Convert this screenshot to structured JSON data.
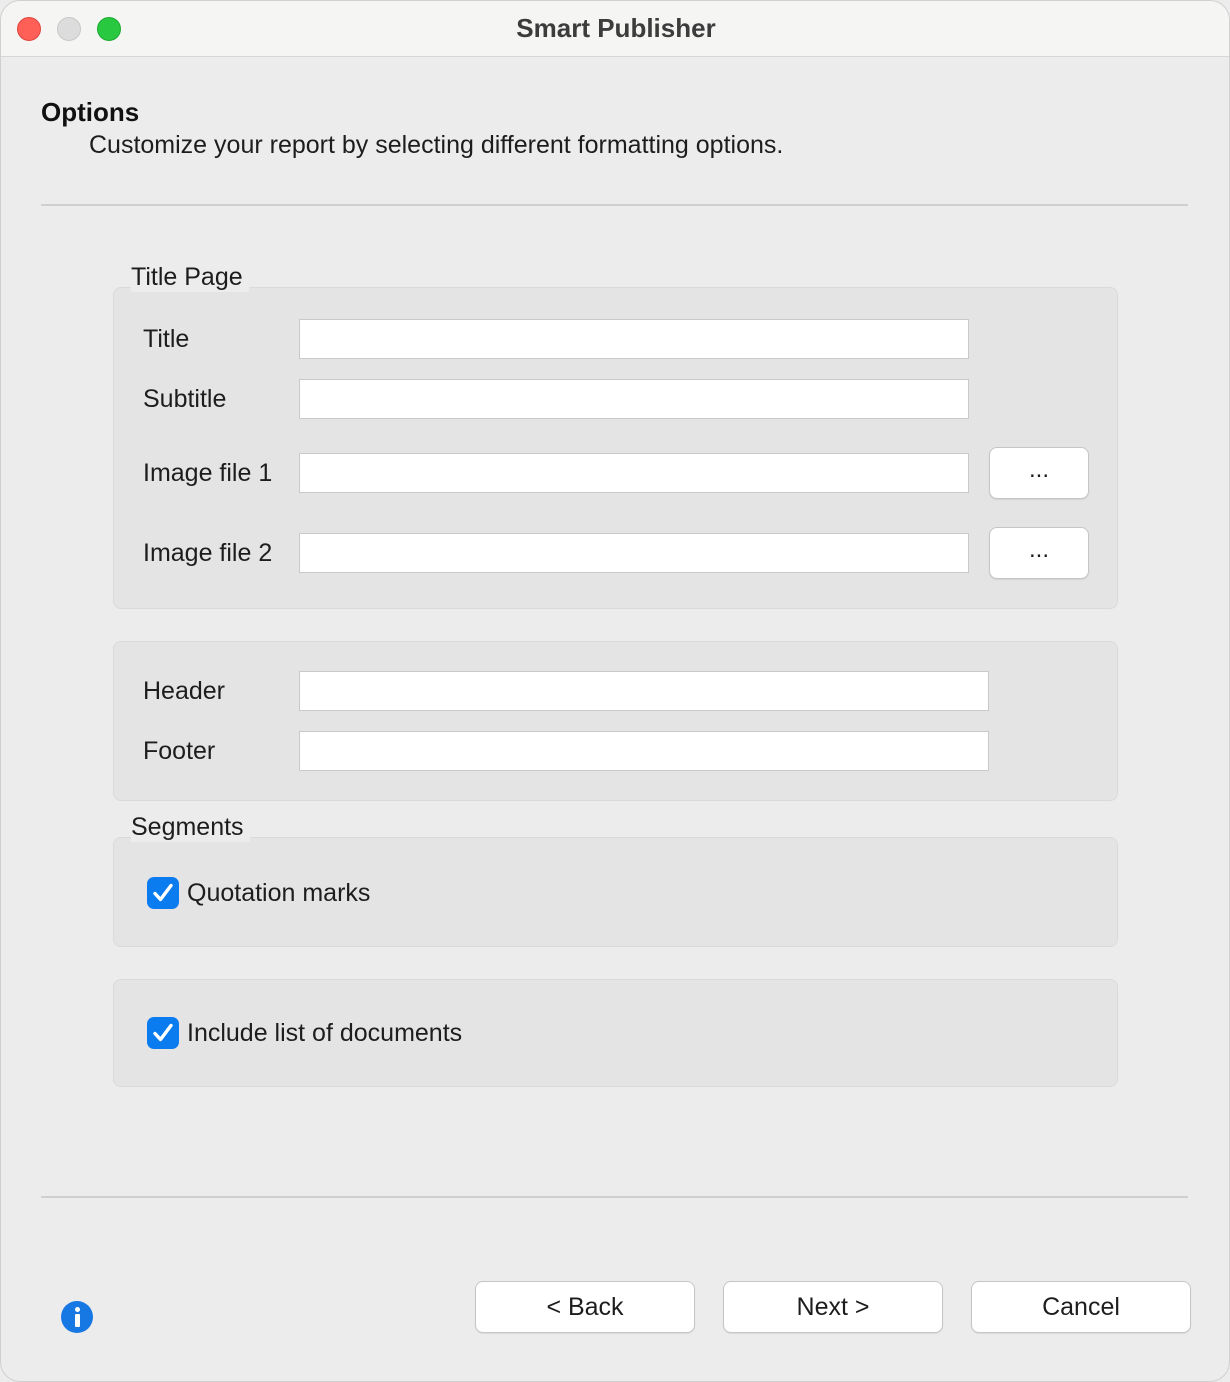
{
  "window": {
    "title": "Smart Publisher"
  },
  "page": {
    "heading": "Options",
    "description": "Customize your report by selecting different formatting options."
  },
  "title_page": {
    "group_label": "Title Page",
    "title_label": "Title",
    "title_value": "",
    "subtitle_label": "Subtitle",
    "subtitle_value": "",
    "image1_label": "Image file 1",
    "image1_value": "",
    "image2_label": "Image file 2",
    "image2_value": "",
    "browse_label": "..."
  },
  "header_footer": {
    "header_label": "Header",
    "header_value": "",
    "footer_label": "Footer",
    "footer_value": ""
  },
  "segments": {
    "group_label": "Segments",
    "quotation_marks_label": "Quotation marks",
    "quotation_marks_checked": true
  },
  "documents": {
    "include_list_label": "Include list of documents",
    "include_list_checked": true
  },
  "footer": {
    "back_label": "< Back",
    "next_label": "Next >",
    "cancel_label": "Cancel"
  },
  "colors": {
    "accent": "#0a7cf0",
    "info": "#1778e3"
  }
}
